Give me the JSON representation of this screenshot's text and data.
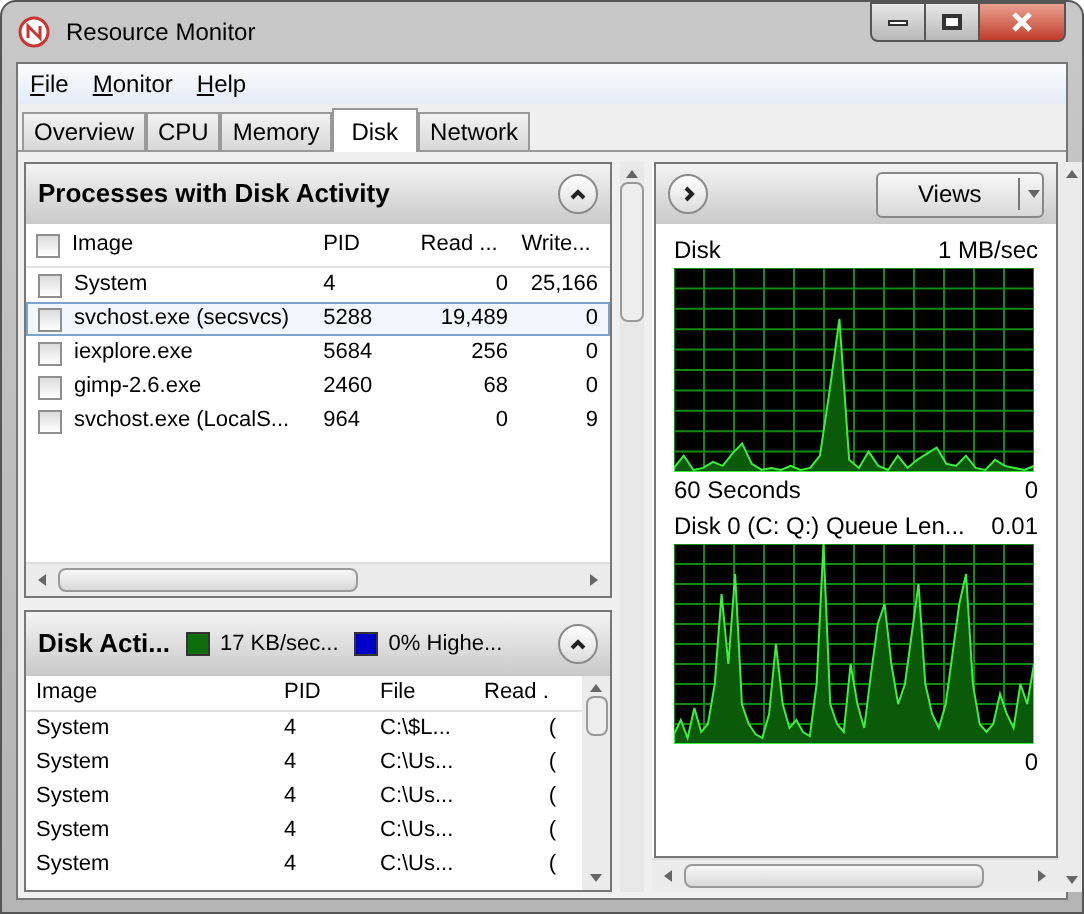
{
  "window": {
    "title": "Resource Monitor"
  },
  "menu": [
    "File",
    "Monitor",
    "Help"
  ],
  "tabs": [
    {
      "label": "Overview",
      "selected": false
    },
    {
      "label": "CPU",
      "selected": false
    },
    {
      "label": "Memory",
      "selected": false
    },
    {
      "label": "Disk",
      "selected": true
    },
    {
      "label": "Network",
      "selected": false
    }
  ],
  "processes": {
    "title": "Processes with Disk Activity",
    "all_checked": false,
    "columns": [
      "Image",
      "PID",
      "Read ...",
      "Write..."
    ],
    "rows": [
      {
        "cells": [
          "System",
          "4",
          "0",
          "25,166"
        ],
        "checked": false,
        "selected": false
      },
      {
        "cells": [
          "svchost.exe (secsvcs)",
          "5288",
          "19,489",
          "0"
        ],
        "checked": false,
        "selected": true
      },
      {
        "cells": [
          "iexplore.exe",
          "5684",
          "256",
          "0"
        ],
        "checked": false,
        "selected": false
      },
      {
        "cells": [
          "gimp-2.6.exe",
          "2460",
          "68",
          "0"
        ],
        "checked": false,
        "selected": false
      },
      {
        "cells": [
          "svchost.exe (LocalS...",
          "964",
          "0",
          "9"
        ],
        "checked": false,
        "selected": false
      }
    ]
  },
  "disk_activity": {
    "title": "Disk Acti...",
    "legend": [
      {
        "label": "17 KB/sec...",
        "color": "#0b6e0b"
      },
      {
        "label": "0% Highe...",
        "color": "#0000c8"
      }
    ],
    "columns": [
      "Image",
      "PID",
      "File",
      "Read ."
    ],
    "rows": [
      [
        "System",
        "4",
        "C:\\$L...",
        "("
      ],
      [
        "System",
        "4",
        "C:\\Us...",
        "("
      ],
      [
        "System",
        "4",
        "C:\\Us...",
        "("
      ],
      [
        "System",
        "4",
        "C:\\Us...",
        "("
      ],
      [
        "System",
        "4",
        "C:\\Us...",
        "("
      ]
    ]
  },
  "graphs": {
    "views_button": "Views",
    "items": [
      {
        "title": "Disk",
        "max": "1 MB/sec",
        "time": "60 Seconds",
        "min": "0"
      },
      {
        "title": "Disk 0 (C: Q:) Queue Len...",
        "max": "0.01",
        "min": "0"
      }
    ]
  }
}
